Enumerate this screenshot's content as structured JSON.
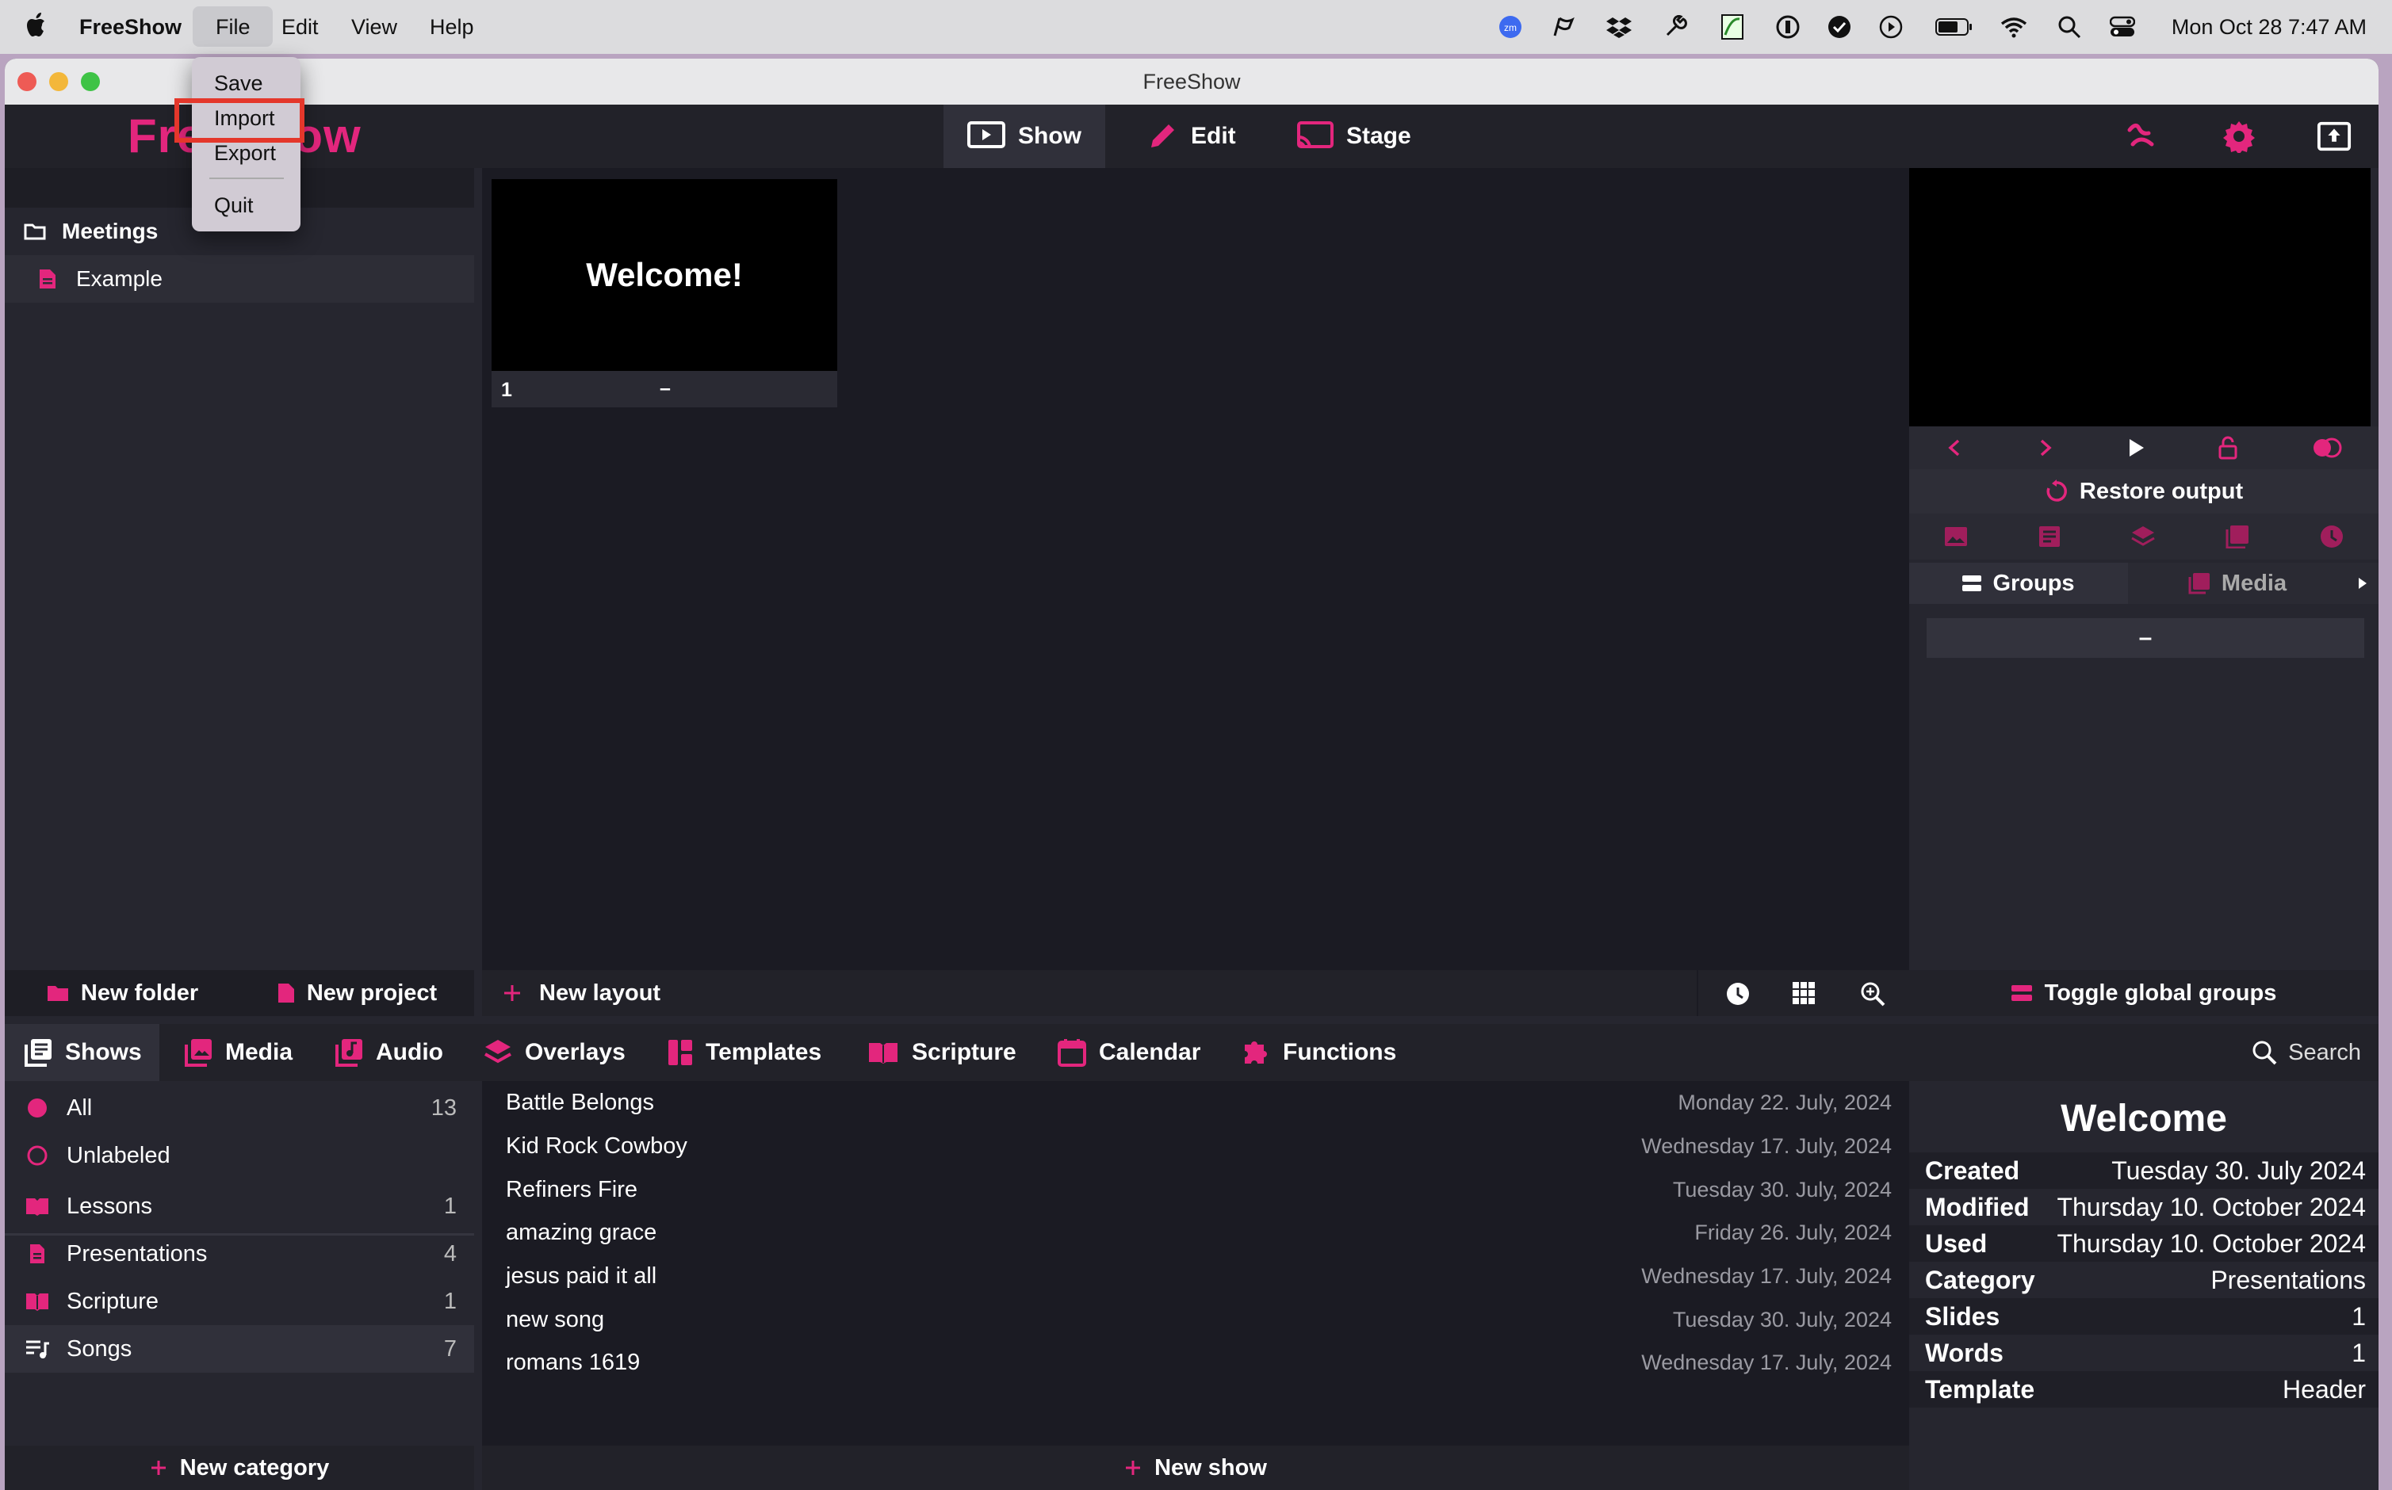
{
  "mac_menubar": {
    "app": "FreeShow",
    "menus": [
      "File",
      "Edit",
      "View",
      "Help"
    ],
    "clock": "Mon Oct 28  7:47 AM"
  },
  "window": {
    "title": "FreeShow"
  },
  "app": {
    "logo": "FreeShow",
    "top_tabs": [
      "Show",
      "Edit",
      "Stage"
    ]
  },
  "file_menu": {
    "items": [
      "Save",
      "Import",
      "Export",
      "Quit"
    ],
    "highlighted": "Import"
  },
  "projects": {
    "folder": "Meetings",
    "project": "Example",
    "footer": [
      "New folder",
      "New project"
    ]
  },
  "slides": [
    {
      "text": "Welcome!",
      "number": "1",
      "group": "–"
    }
  ],
  "layout": {
    "new_layout": "New layout"
  },
  "output": {
    "restore": "Restore output",
    "group_tabs": [
      "Groups",
      "Media"
    ],
    "group_item": "–",
    "toggle_global": "Toggle global groups"
  },
  "drawer": {
    "tabs": [
      "Shows",
      "Media",
      "Audio",
      "Overlays",
      "Templates",
      "Scripture",
      "Calendar",
      "Functions"
    ],
    "search": "Search",
    "categories": [
      {
        "label": "All",
        "count": "13"
      },
      {
        "label": "Unlabeled",
        "count": ""
      },
      {
        "label": "Lessons",
        "count": "1"
      },
      {
        "label": "Presentations",
        "count": "4"
      },
      {
        "label": "Scripture",
        "count": "1"
      },
      {
        "label": "Songs",
        "count": "7"
      }
    ],
    "new_category": "New category",
    "shows": [
      {
        "name": "Battle Belongs",
        "date": "Monday 22. July, 2024"
      },
      {
        "name": "Kid Rock Cowboy",
        "date": "Wednesday 17. July, 2024"
      },
      {
        "name": "Refiners Fire",
        "date": "Tuesday 30. July, 2024"
      },
      {
        "name": "amazing grace",
        "date": "Friday 26. July, 2024"
      },
      {
        "name": "jesus paid it all",
        "date": "Wednesday 17. July, 2024"
      },
      {
        "name": "new song",
        "date": "Tuesday 30. July, 2024"
      },
      {
        "name": "romans 1619",
        "date": "Wednesday 17. July, 2024"
      }
    ],
    "new_show": "New show"
  },
  "info": {
    "title": "Welcome",
    "rows": [
      {
        "k": "Created",
        "v": "Tuesday 30. July 2024"
      },
      {
        "k": "Modified",
        "v": "Thursday 10. October 2024"
      },
      {
        "k": "Used",
        "v": "Thursday 10. October 2024"
      },
      {
        "k": "Category",
        "v": "Presentations"
      },
      {
        "k": "Slides",
        "v": "1"
      },
      {
        "k": "Words",
        "v": "1"
      },
      {
        "k": "Template",
        "v": "Header"
      }
    ]
  },
  "colors": {
    "accent": "#e3267d",
    "highlight_box": "#e4372b",
    "bg": "#1b1b23"
  }
}
